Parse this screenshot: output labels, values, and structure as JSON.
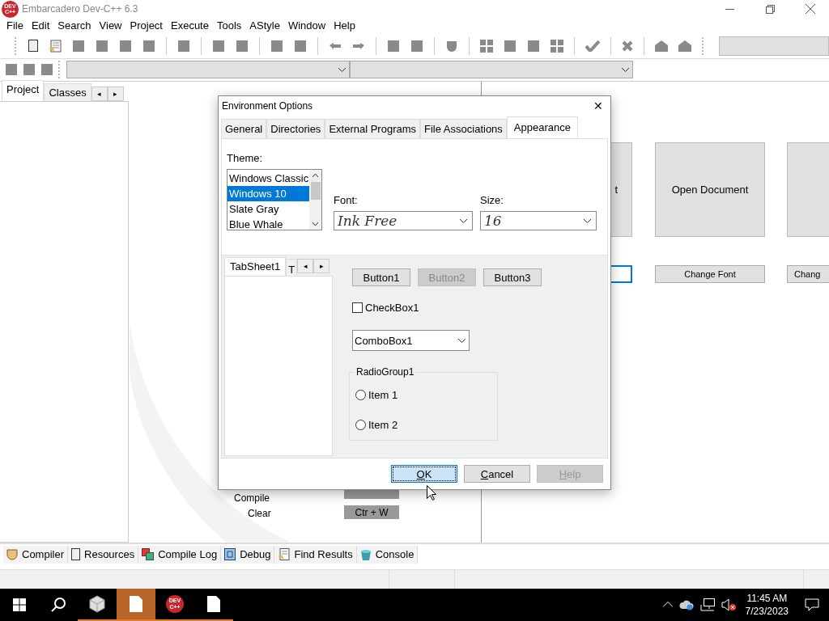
{
  "window": {
    "logo": "DEV C++",
    "title": "Embarcadero Dev-C++ 6.3"
  },
  "menu": [
    "File",
    "Edit",
    "Search",
    "View",
    "Project",
    "Execute",
    "Tools",
    "AStyle",
    "Window",
    "Help"
  ],
  "left_panel": {
    "tabs": [
      {
        "label": "Project",
        "selected": true
      },
      {
        "label": "Classes",
        "selected": false
      }
    ],
    "scroll_left": "◂",
    "scroll_right": "▸"
  },
  "welcome": {
    "tiles": [
      {
        "label": "t"
      },
      {
        "label": "Open Document"
      }
    ],
    "tile_buttons": [
      {
        "focused": true
      },
      {
        "label": "Change Font",
        "focused": false
      },
      {
        "label": "Chang",
        "focused": false
      }
    ],
    "shortcuts": [
      {
        "action": "Compile"
      },
      {
        "action": "Clear",
        "key": "Ctr + W"
      }
    ]
  },
  "dialog": {
    "title": "Environment Options",
    "close": "✕",
    "tabs": [
      {
        "label": "General",
        "selected": false
      },
      {
        "label": "Directories",
        "selected": false
      },
      {
        "label": "External Programs",
        "selected": false
      },
      {
        "label": "File Associations",
        "selected": false
      },
      {
        "label": "Appearance",
        "selected": true
      }
    ],
    "theme": {
      "label": "Theme:",
      "items": [
        {
          "label": "Windows Classic",
          "selected": false
        },
        {
          "label": "Windows 10",
          "selected": true
        },
        {
          "label": "Slate Gray",
          "selected": false
        },
        {
          "label": "Blue Whale",
          "selected": false
        }
      ]
    },
    "font": {
      "label": "Font:",
      "value": "Ink Free"
    },
    "size": {
      "label": "Size:",
      "value": "16"
    },
    "preview": {
      "tabs": [
        {
          "label": "TabSheet1",
          "selected": true
        },
        {
          "label": "T",
          "selected": false
        }
      ],
      "scroll_left": "◂",
      "scroll_right": "▸",
      "buttons": [
        {
          "label": "Button1",
          "disabled": false
        },
        {
          "label": "Button2",
          "disabled": true
        },
        {
          "label": "Button3",
          "disabled": false
        }
      ],
      "checkbox": {
        "label": "CheckBox1",
        "checked": false
      },
      "combo": {
        "value": "ComboBox1"
      },
      "radio_group": {
        "title": "RadioGroup1",
        "items": [
          {
            "label": "Item 1",
            "selected": false
          },
          {
            "label": "Item 2",
            "selected": false
          }
        ]
      }
    },
    "buttons": [
      {
        "key": "O",
        "rest": "K",
        "focused": true,
        "disabled": false
      },
      {
        "key": "C",
        "rest": "ancel",
        "focused": false,
        "disabled": false
      },
      {
        "key": "H",
        "rest": "elp",
        "focused": false,
        "disabled": true
      }
    ]
  },
  "bottom_tabs": [
    {
      "label": "Compiler",
      "kind": "compiler"
    },
    {
      "label": "Resources",
      "kind": "resources"
    },
    {
      "label": "Compile Log",
      "kind": "log"
    },
    {
      "label": "Debug",
      "kind": "debug"
    },
    {
      "label": "Find Results",
      "kind": "find"
    },
    {
      "label": "Console",
      "kind": "console"
    }
  ],
  "taskbar": {
    "apps": [
      {
        "kind": "cube",
        "selected": false
      },
      {
        "kind": "file",
        "selected": true
      },
      {
        "kind": "devcpp",
        "text": "DEV C++",
        "selected": false
      },
      {
        "kind": "file",
        "selected": false
      }
    ],
    "time": "11:45 AM",
    "date": "7/23/2023"
  }
}
